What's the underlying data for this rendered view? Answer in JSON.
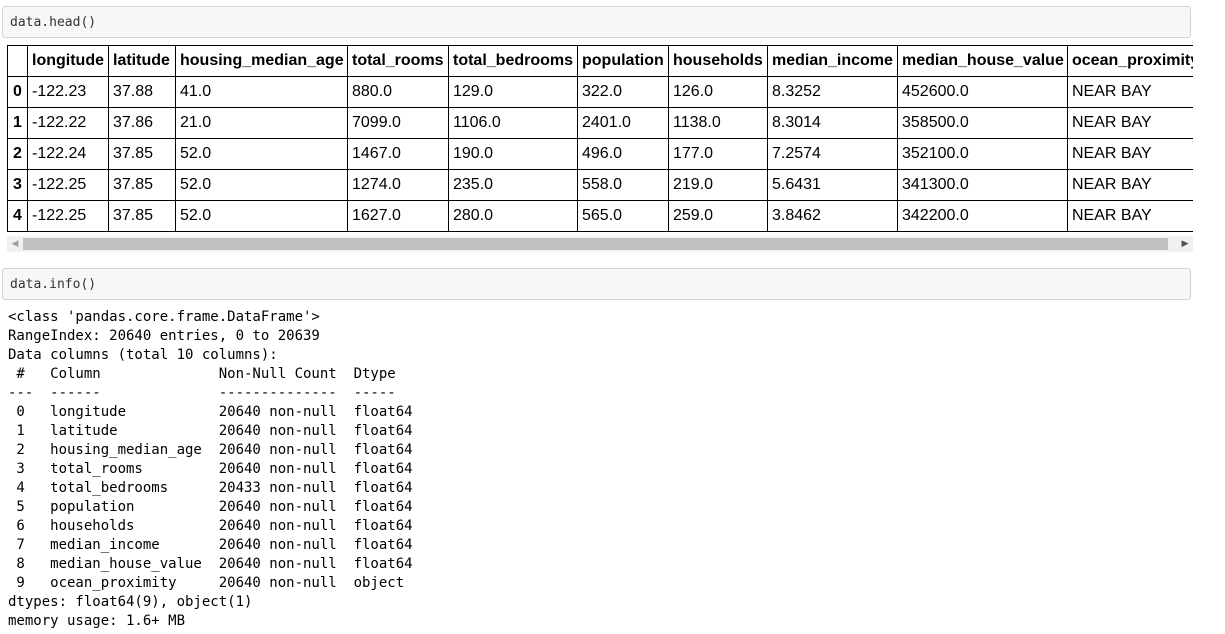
{
  "cells": [
    {
      "code": "data.head()"
    },
    {
      "code": "data.info()"
    }
  ],
  "dataframe": {
    "columns": [
      "",
      "longitude",
      "latitude",
      "housing_median_age",
      "total_rooms",
      "total_bedrooms",
      "population",
      "households",
      "median_income",
      "median_house_value",
      "ocean_proximity"
    ],
    "rows": [
      [
        "0",
        "-122.23",
        "37.88",
        "41.0",
        "880.0",
        "129.0",
        "322.0",
        "126.0",
        "8.3252",
        "452600.0",
        "NEAR BAY"
      ],
      [
        "1",
        "-122.22",
        "37.86",
        "21.0",
        "7099.0",
        "1106.0",
        "2401.0",
        "1138.0",
        "8.3014",
        "358500.0",
        "NEAR BAY"
      ],
      [
        "2",
        "-122.24",
        "37.85",
        "52.0",
        "1467.0",
        "190.0",
        "496.0",
        "177.0",
        "7.2574",
        "352100.0",
        "NEAR BAY"
      ],
      [
        "3",
        "-122.25",
        "37.85",
        "52.0",
        "1274.0",
        "235.0",
        "558.0",
        "219.0",
        "5.6431",
        "341300.0",
        "NEAR BAY"
      ],
      [
        "4",
        "-122.25",
        "37.85",
        "52.0",
        "1627.0",
        "280.0",
        "565.0",
        "259.0",
        "3.8462",
        "342200.0",
        "NEAR BAY"
      ]
    ]
  },
  "scrollbar": {
    "left_arrow": "◀",
    "right_arrow": "▶"
  },
  "info_output": [
    "<class 'pandas.core.frame.DataFrame'>",
    "RangeIndex: 20640 entries, 0 to 20639",
    "Data columns (total 10 columns):",
    " #   Column              Non-Null Count  Dtype  ",
    "---  ------              --------------  -----  ",
    " 0   longitude           20640 non-null  float64",
    " 1   latitude            20640 non-null  float64",
    " 2   housing_median_age  20640 non-null  float64",
    " 3   total_rooms         20640 non-null  float64",
    " 4   total_bedrooms      20433 non-null  float64",
    " 5   population          20640 non-null  float64",
    " 6   households          20640 non-null  float64",
    " 7   median_income       20640 non-null  float64",
    " 8   median_house_value  20640 non-null  float64",
    " 9   ocean_proximity     20640 non-null  object ",
    "dtypes: float64(9), object(1)",
    "memory usage: 1.6+ MB"
  ]
}
